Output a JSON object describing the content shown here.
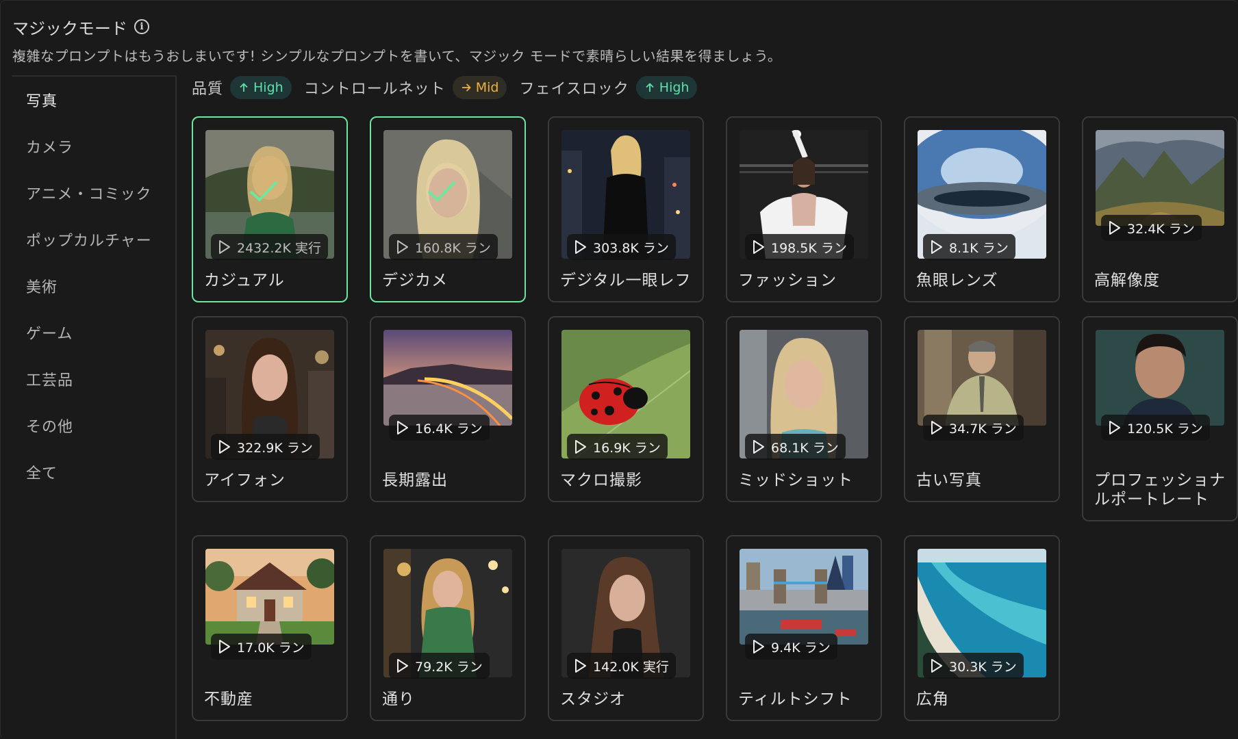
{
  "header": {
    "title": "マジックモード",
    "subtitle": "複雑なプロンプトはもうおしまいです! シンプルなプロンプトを書いて、マジック モードで素晴らしい結果を得ましょう。"
  },
  "sidebar": {
    "items": [
      {
        "label": "写真",
        "active": true
      },
      {
        "label": "カメラ"
      },
      {
        "label": "アニメ・コミック"
      },
      {
        "label": "ポップカルチャー"
      },
      {
        "label": "美術"
      },
      {
        "label": "ゲーム"
      },
      {
        "label": "工芸品"
      },
      {
        "label": "その他"
      },
      {
        "label": "全て"
      }
    ]
  },
  "params": [
    {
      "label": "品質",
      "value": "High",
      "icon": "arrow-up-icon",
      "color": "#5fe0a8"
    },
    {
      "label": "コントロールネット",
      "value": "Mid",
      "icon": "arrow-right-icon",
      "color": "#f0b040"
    },
    {
      "label": "フェイスロック",
      "value": "High",
      "icon": "arrow-up-icon",
      "color": "#5fe0a8"
    }
  ],
  "cards": [
    {
      "label": "カジュアル",
      "count": "2432.2K 実行",
      "selected": true
    },
    {
      "label": "デジカメ",
      "count": "160.8K ラン",
      "selected": true
    },
    {
      "label": "デジタル一眼レフ",
      "count": "303.8K ラン"
    },
    {
      "label": "ファッション",
      "count": "198.5K ラン"
    },
    {
      "label": "魚眼レンズ",
      "count": "8.1K ラン"
    },
    {
      "label": "高解像度",
      "count": "32.4K ラン"
    },
    {
      "label": "アイフォン",
      "count": "322.9K ラン"
    },
    {
      "label": "長期露出",
      "count": "16.4K ラン"
    },
    {
      "label": "マクロ撮影",
      "count": "16.9K ラン"
    },
    {
      "label": "ミッドショット",
      "count": "68.1K ラン"
    },
    {
      "label": "古い写真",
      "count": "34.7K ラン"
    },
    {
      "label": "プロフェッショナルポートレート",
      "count": "120.5K ラン"
    },
    {
      "label": "不動産",
      "count": "17.0K ラン"
    },
    {
      "label": "通り",
      "count": "79.2K ラン"
    },
    {
      "label": "スタジオ",
      "count": "142.0K 実行"
    },
    {
      "label": "ティルトシフト",
      "count": "9.4K ラン"
    },
    {
      "label": "広角",
      "count": "30.3K ラン"
    }
  ]
}
